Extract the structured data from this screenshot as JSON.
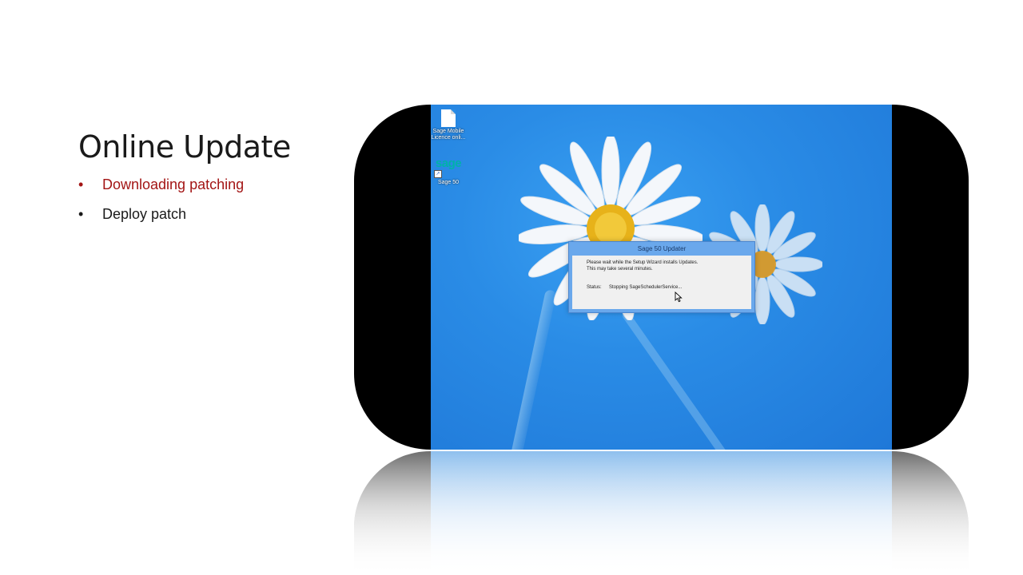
{
  "slide": {
    "title": "Online Update",
    "bullets": [
      {
        "text": "Downloading patching",
        "state": "active"
      },
      {
        "text": "Deploy patch",
        "state": "normal"
      }
    ],
    "bullet_symbol": "•",
    "colors": {
      "active_bullet": "#a31515",
      "normal_text": "#1a1a1a"
    }
  },
  "desktop": {
    "icons": [
      {
        "label": "Sage Mobile Licence onli...",
        "icon": "document-icon"
      },
      {
        "label": "Sage 50",
        "icon": "sage-logo-icon",
        "logo_text": "sage"
      }
    ],
    "wallpaper_color": "#2a8ce6"
  },
  "dialog": {
    "title": "Sage 50 Updater",
    "message_line1": "Please wait while the Setup Wizard installs Updates.",
    "message_line2": "This may take several minutes.",
    "status_label": "Status:",
    "status_value": "Stopping SageSchedulerService..."
  }
}
